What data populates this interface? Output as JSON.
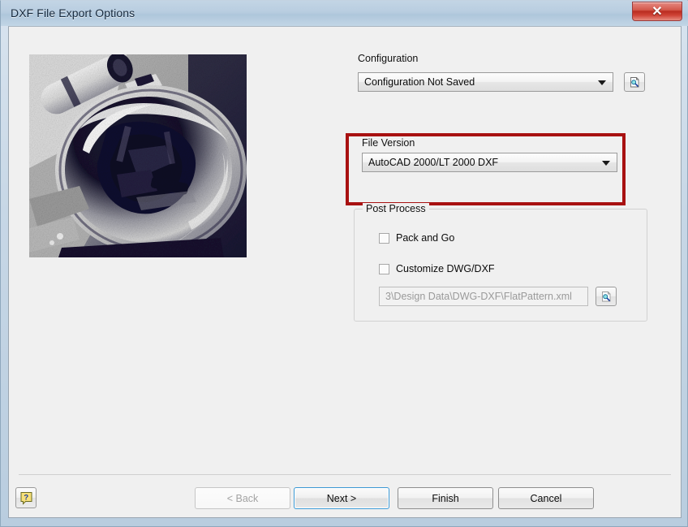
{
  "window": {
    "title": "DXF File Export Options",
    "close_label": "✕"
  },
  "preview": {
    "alt": "machined-part-preview"
  },
  "configuration": {
    "label": "Configuration",
    "value": "Configuration Not Saved",
    "browse_icon": "document-magnifier-icon"
  },
  "file_version": {
    "label": "File Version",
    "value": "AutoCAD 2000/LT 2000 DXF",
    "highlight_color": "#a81111"
  },
  "post_process": {
    "label": "Post Process",
    "pack_and_go": {
      "label": "Pack and Go",
      "checked": false
    },
    "customize": {
      "label": "Customize DWG/DXF",
      "checked": false
    },
    "path": {
      "value": "3\\Design Data\\DWG-DXF\\FlatPattern.xml",
      "placeholder": "3\\Design Data\\DWG-DXF\\FlatPattern.xml"
    },
    "browse_icon": "document-magnifier-icon"
  },
  "footer": {
    "help_label": "?",
    "back_label": "< Back",
    "next_label": "Next >",
    "finish_label": "Finish",
    "cancel_label": "Cancel"
  }
}
